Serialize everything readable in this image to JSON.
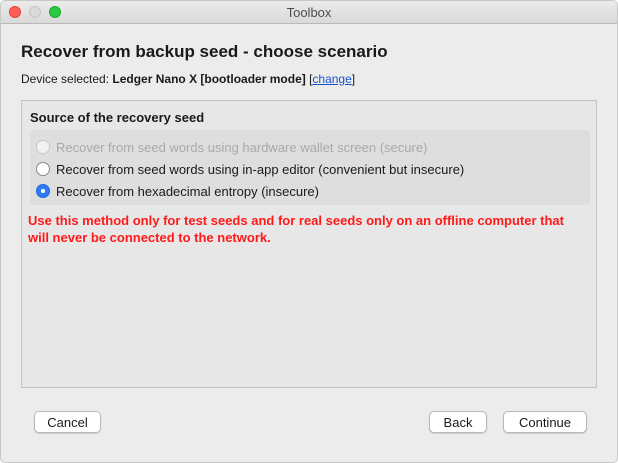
{
  "window": {
    "title": "Toolbox"
  },
  "page": {
    "heading": "Recover from backup seed - choose scenario",
    "device_label": "Device selected: ",
    "device_name": "Ledger Nano X [bootloader mode]",
    "change_open": " [",
    "change_link": "change",
    "change_close": "]"
  },
  "recovery": {
    "section_title": "Source of the recovery seed",
    "options": [
      {
        "label": "Recover from seed words using hardware wallet screen (secure)",
        "enabled": false,
        "selected": false
      },
      {
        "label": "Recover from seed words using in-app editor (convenient but insecure)",
        "enabled": true,
        "selected": false
      },
      {
        "label": "Recover from hexadecimal entropy (insecure)",
        "enabled": true,
        "selected": true
      }
    ],
    "warning": "Use this method only for test seeds and for real seeds only on an offline computer that will never be connected to the network.",
    "warning_color": "#ff1a1a"
  },
  "buttons": {
    "cancel": "Cancel",
    "back": "Back",
    "continue": "Continue"
  },
  "colors": {
    "accent": "#2d7cf6",
    "link": "#1a55c8",
    "close": "#fe5f57",
    "zoom": "#29c941"
  }
}
